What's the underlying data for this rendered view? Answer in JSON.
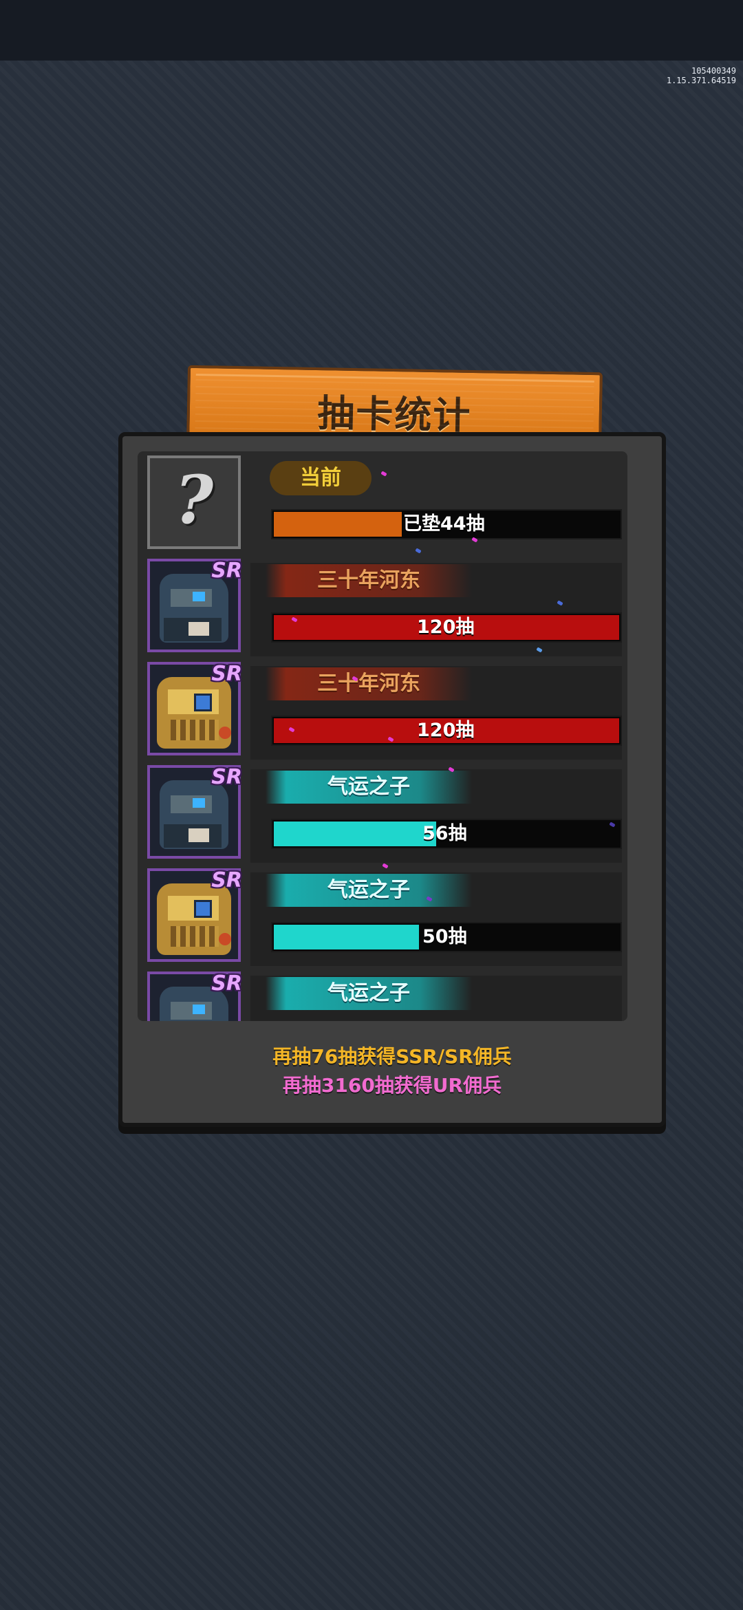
{
  "version": {
    "build": "105400349",
    "server": "1.15.371.64519"
  },
  "title": "抽卡统计",
  "rows": [
    {
      "type": "current",
      "label": "当前",
      "bar_text": "已垫44抽",
      "badge": "",
      "fill_fraction": 0.37,
      "fill_color": "#d4620f"
    },
    {
      "type": "red",
      "label": "三十年河东",
      "bar_text": "120抽",
      "badge": "SR",
      "portrait": "blue-robot",
      "fill_fraction": 1.0,
      "fill_color": "#b80e0e"
    },
    {
      "type": "red",
      "label": "三十年河东",
      "bar_text": "120抽",
      "badge": "SR",
      "portrait": "gold-robot",
      "fill_fraction": 1.0,
      "fill_color": "#b80e0e"
    },
    {
      "type": "cyan",
      "label": "气运之子",
      "bar_text": "56抽",
      "badge": "SR",
      "portrait": "blue-robot",
      "fill_fraction": 0.47,
      "fill_color": "#1fd6cc"
    },
    {
      "type": "cyan",
      "label": "气运之子",
      "bar_text": "50抽",
      "badge": "SR",
      "portrait": "gold-robot",
      "fill_fraction": 0.42,
      "fill_color": "#1fd6cc"
    },
    {
      "type": "cyan",
      "label": "气运之子",
      "bar_text": "",
      "badge": "SR",
      "portrait": "blue-robot",
      "fill_fraction": 0,
      "fill_color": "#1fd6cc"
    }
  ],
  "footer": {
    "ssr_hint": "再抽76抽获得SSR/SR佣兵",
    "ur_hint": "再抽3160抽获得UR佣兵"
  },
  "colors": {
    "current_fill": "#d4620f",
    "red_fill": "#b80e0e",
    "cyan_fill": "#1fd6cc",
    "sr_badge": "#e7a6ff",
    "ssr_hint": "#f4b626",
    "ur_hint": "#f26bd0"
  }
}
